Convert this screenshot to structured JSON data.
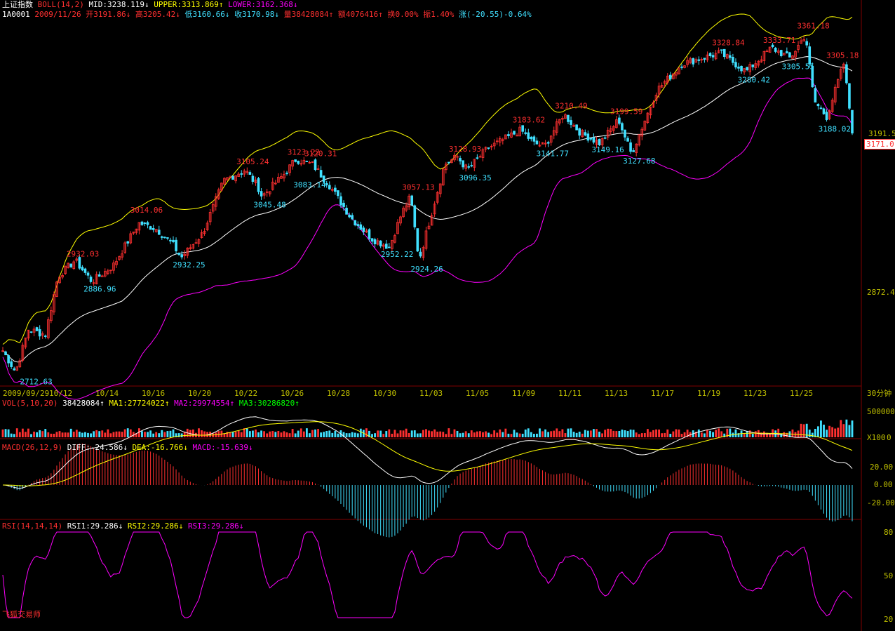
{
  "header": {
    "index_name": "上证指数",
    "boll_label": "BOLL(14,2)",
    "mid": "MID:3238.119↓",
    "upper": "UPPER:3313.869↑",
    "lower": "LOWER:3162.368↓",
    "code": "1A0001",
    "date": "2009/11/26",
    "open": "开3191.86↓",
    "high": "高3205.42↓",
    "low": "低3160.66↓",
    "close": "收3170.98↓",
    "volume": "量38428084↑",
    "amount": "额4076416↑",
    "turnover": "换0.00%",
    "amplitude": "振1.40%",
    "change": "涨(-20.55)-0.64%"
  },
  "price_axis": {
    "labels": [
      "3191.5",
      "2872.4"
    ],
    "current": "3171.0"
  },
  "date_axis": {
    "labels": [
      "2009/09/29",
      "10/12",
      "10/14",
      "10/16",
      "10/20",
      "10/22",
      "10/26",
      "10/28",
      "10/30",
      "11/03",
      "11/05",
      "11/09",
      "11/11",
      "11/13",
      "11/17",
      "11/19",
      "11/23",
      "11/25"
    ],
    "period": "30分钟"
  },
  "vol_panel": {
    "label": "VOL(5,10,20)",
    "value": "38428084↑",
    "ma1": "MA1:27724022↑",
    "ma2": "MA2:29974554↑",
    "ma3": "MA3:30286820↑",
    "axis_top": "500000",
    "axis_unit": "X100",
    "axis_zero": "0"
  },
  "macd_panel": {
    "label": "MACD(26,12,9)",
    "diff": "DIFF:-24.586↓",
    "dea": "DEA:-16.766↓",
    "macd": "MACD:-15.639↓",
    "axis": [
      "20.00",
      "0.00",
      "-20.00"
    ]
  },
  "rsi_panel": {
    "label": "RSI(14,14,14)",
    "rsi1": "RSI1:29.286↓",
    "rsi2": "RSI2:29.286↓",
    "rsi3": "RSI3:29.286↓",
    "axis": [
      "80",
      "50",
      "20"
    ]
  },
  "watermark": "飞狐交易师",
  "colors": {
    "up": "#ff3030",
    "down": "#40e0ff",
    "upper": "#ffff00",
    "mid": "#ffffff",
    "lower": "#ff00ff",
    "grid": "#800000"
  },
  "chart_data": {
    "type": "candlestick",
    "price_range": [
      2700,
      3380
    ],
    "annotations": [
      {
        "text": "2712.63",
        "value": 2712.63,
        "kind": "low",
        "pos": 0.03
      },
      {
        "text": "2932.03",
        "value": 2932.03,
        "kind": "high",
        "pos": 0.085
      },
      {
        "text": "2886.96",
        "value": 2886.96,
        "kind": "low",
        "pos": 0.105
      },
      {
        "text": "3014.06",
        "value": 3014.06,
        "kind": "high",
        "pos": 0.16
      },
      {
        "text": "2932.25",
        "value": 2932.25,
        "kind": "low",
        "pos": 0.21
      },
      {
        "text": "3105.24",
        "value": 3105.24,
        "kind": "high",
        "pos": 0.285
      },
      {
        "text": "3045.48",
        "value": 3045.48,
        "kind": "low",
        "pos": 0.305
      },
      {
        "text": "3123.22",
        "value": 3123.22,
        "kind": "high",
        "pos": 0.345
      },
      {
        "text": "3120.31",
        "value": 3120.31,
        "kind": "high",
        "pos": 0.365
      },
      {
        "text": "3083.14",
        "value": 3083.14,
        "kind": "low",
        "pos": 0.352
      },
      {
        "text": "3057.13",
        "value": 3057.13,
        "kind": "high",
        "pos": 0.48
      },
      {
        "text": "2952.22",
        "value": 2952.22,
        "kind": "low",
        "pos": 0.455
      },
      {
        "text": "2924.26",
        "value": 2924.26,
        "kind": "low",
        "pos": 0.49
      },
      {
        "text": "3128.93",
        "value": 3128.93,
        "kind": "high",
        "pos": 0.535
      },
      {
        "text": "3096.35",
        "value": 3096.35,
        "kind": "low",
        "pos": 0.547
      },
      {
        "text": "3183.62",
        "value": 3183.62,
        "kind": "high",
        "pos": 0.61
      },
      {
        "text": "3210.49",
        "value": 3210.49,
        "kind": "high",
        "pos": 0.66
      },
      {
        "text": "3141.77",
        "value": 3141.77,
        "kind": "low",
        "pos": 0.638
      },
      {
        "text": "3149.16",
        "value": 3149.16,
        "kind": "low",
        "pos": 0.703
      },
      {
        "text": "3199.59",
        "value": 3199.59,
        "kind": "high",
        "pos": 0.725
      },
      {
        "text": "3127.68",
        "value": 3127.68,
        "kind": "low",
        "pos": 0.74
      },
      {
        "text": "3328.84",
        "value": 3328.84,
        "kind": "high",
        "pos": 0.845
      },
      {
        "text": "3280.42",
        "value": 3280.42,
        "kind": "low",
        "pos": 0.875
      },
      {
        "text": "3333.71",
        "value": 3333.71,
        "kind": "high",
        "pos": 0.905
      },
      {
        "text": "3305.55",
        "value": 3305.55,
        "kind": "low",
        "pos": 0.927
      },
      {
        "text": "3361.18",
        "value": 3361.18,
        "kind": "high",
        "pos": 0.945
      },
      {
        "text": "3305.18",
        "value": 3305.18,
        "kind": "high",
        "pos": 0.99
      },
      {
        "text": "3188.02",
        "value": 3188.02,
        "kind": "low",
        "pos": 0.97
      }
    ],
    "path": [
      [
        0,
        2760
      ],
      [
        0.015,
        2720
      ],
      [
        0.03,
        2800
      ],
      [
        0.05,
        2790
      ],
      [
        0.065,
        2900
      ],
      [
        0.085,
        2930
      ],
      [
        0.1,
        2900
      ],
      [
        0.105,
        2890
      ],
      [
        0.13,
        2920
      ],
      [
        0.16,
        3000
      ],
      [
        0.18,
        2990
      ],
      [
        0.2,
        2960
      ],
      [
        0.21,
        2935
      ],
      [
        0.235,
        2980
      ],
      [
        0.26,
        3080
      ],
      [
        0.285,
        3100
      ],
      [
        0.3,
        3070
      ],
      [
        0.305,
        3050
      ],
      [
        0.33,
        3090
      ],
      [
        0.345,
        3120
      ],
      [
        0.365,
        3110
      ],
      [
        0.385,
        3070
      ],
      [
        0.41,
        3010
      ],
      [
        0.435,
        2970
      ],
      [
        0.455,
        2955
      ],
      [
        0.47,
        3020
      ],
      [
        0.48,
        3050
      ],
      [
        0.49,
        2930
      ],
      [
        0.505,
        3020
      ],
      [
        0.52,
        3110
      ],
      [
        0.535,
        3125
      ],
      [
        0.547,
        3100
      ],
      [
        0.57,
        3140
      ],
      [
        0.61,
        3175
      ],
      [
        0.625,
        3150
      ],
      [
        0.638,
        3145
      ],
      [
        0.66,
        3205
      ],
      [
        0.68,
        3170
      ],
      [
        0.703,
        3150
      ],
      [
        0.725,
        3195
      ],
      [
        0.74,
        3130
      ],
      [
        0.77,
        3250
      ],
      [
        0.8,
        3300
      ],
      [
        0.845,
        3320
      ],
      [
        0.875,
        3285
      ],
      [
        0.905,
        3330
      ],
      [
        0.927,
        3310
      ],
      [
        0.945,
        3355
      ],
      [
        0.955,
        3230
      ],
      [
        0.97,
        3200
      ],
      [
        0.99,
        3300
      ],
      [
        1.0,
        3175
      ]
    ],
    "volume_range": [
      0,
      500000
    ],
    "macd_range": [
      -30,
      30
    ],
    "rsi_range": [
      20,
      80
    ]
  }
}
